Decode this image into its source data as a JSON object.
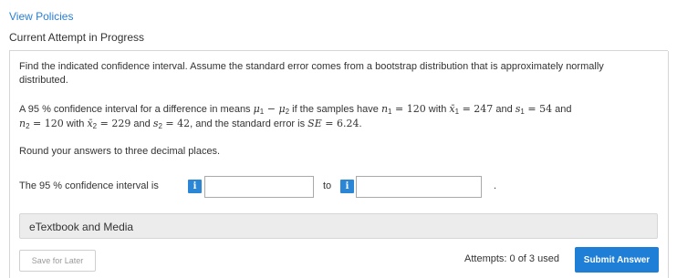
{
  "header": {
    "view_policies": "View Policies",
    "current_attempt": "Current Attempt in Progress"
  },
  "question": {
    "intro_line1": "Find the indicated confidence interval. Assume the standard error comes from a bootstrap distribution that is approximately normally",
    "intro_line2": "distributed.",
    "p2_a": "A 95 % confidence interval for a difference in means ",
    "p2_mu1": "μ",
    "p2_mu1_sub": "1",
    "p2_minus": " − ",
    "p2_mu2": "μ",
    "p2_mu2_sub": "2",
    "p2_b": " if the samples have ",
    "p2_n1": "n",
    "p2_n1_sub": "1",
    "p2_n1_val": " = 120",
    "p2_with1": " with ",
    "p2_x1": "x̄",
    "p2_x1_sub": "1",
    "p2_x1_val": " = 247",
    "p2_and1": " and ",
    "p2_s1": "s",
    "p2_s1_sub": "1",
    "p2_s1_val": " = 54",
    "p2_and2": " and",
    "p3_n2": "n",
    "p3_n2_sub": "2",
    "p3_n2_val": " = 120",
    "p3_with2": " with ",
    "p3_x2": "x̄",
    "p3_x2_sub": "2",
    "p3_x2_val": " = 229",
    "p3_and3": " and ",
    "p3_s2": "s",
    "p3_s2_sub": "2",
    "p3_s2_val": " = 42",
    "p3_se_text": ", and the standard error is ",
    "p3_se": "SE",
    "p3_se_val": " = 6.24",
    "p3_end": ".",
    "round_instruction": "Round your answers to three decimal places."
  },
  "answer": {
    "label": "The 95 % confidence interval is",
    "info_glyph": "i",
    "lower_value": "",
    "to_label": "to",
    "upper_value": "",
    "period": "."
  },
  "etextbook_label": "eTextbook and Media",
  "footer": {
    "save_later": "Save for Later",
    "attempts": "Attempts: 0 of 3 used",
    "submit": "Submit Answer"
  },
  "colors": {
    "link": "#2a7fd4",
    "info_button": "#2b86d6",
    "submit_button": "#1f7ed6"
  }
}
